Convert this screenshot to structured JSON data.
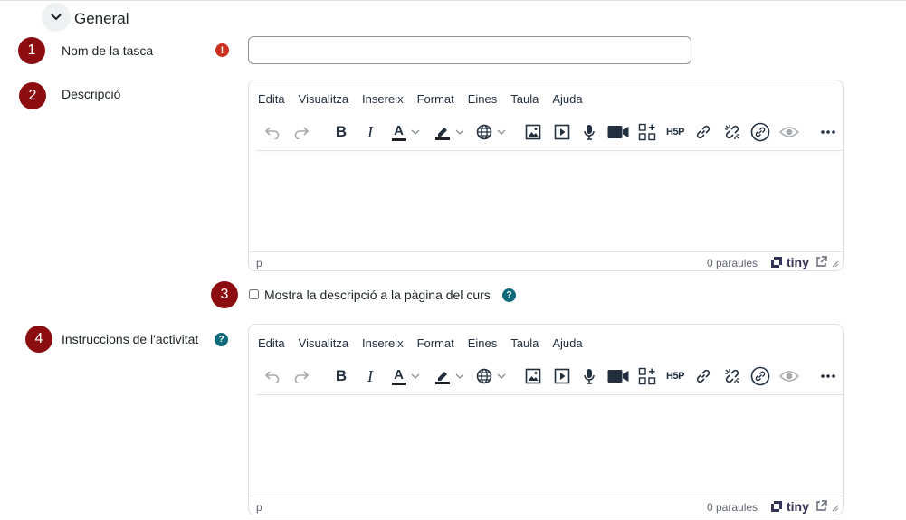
{
  "section": {
    "title": "General"
  },
  "fields": {
    "task_name": {
      "step": "1",
      "label": "Nom de la tasca",
      "required_symbol": "!",
      "value": "",
      "placeholder": ""
    },
    "description": {
      "step": "2",
      "label": "Descripció"
    },
    "show_description": {
      "step": "3",
      "label": "Mostra la descripció a la pàgina del curs",
      "help_symbol": "?",
      "checked": false
    },
    "instructions": {
      "step": "4",
      "label": "Instruccions de l'activitat",
      "help_symbol": "?"
    }
  },
  "editor": {
    "menu": [
      "Edita",
      "Visualitza",
      "Insereix",
      "Format",
      "Eines",
      "Taula",
      "Ajuda"
    ],
    "toolbar_icons": [
      "undo-icon",
      "redo-icon",
      "bold-icon",
      "italic-icon",
      "text-color-icon",
      "highlight-icon",
      "language-icon",
      "image-icon",
      "media-icon",
      "microphone-icon",
      "video-camera-icon",
      "h5p-apps-icon",
      "h5p-icon",
      "link-icon",
      "unlink-icon",
      "no-auto-link-icon",
      "accessibility-icon",
      "more-icon"
    ],
    "bold_glyph": "B",
    "italic_glyph": "I",
    "font_color_glyph": "A",
    "h5p_text": "H5P",
    "status_path": "p",
    "word_count": "0 paraules",
    "brand": "tiny"
  }
}
